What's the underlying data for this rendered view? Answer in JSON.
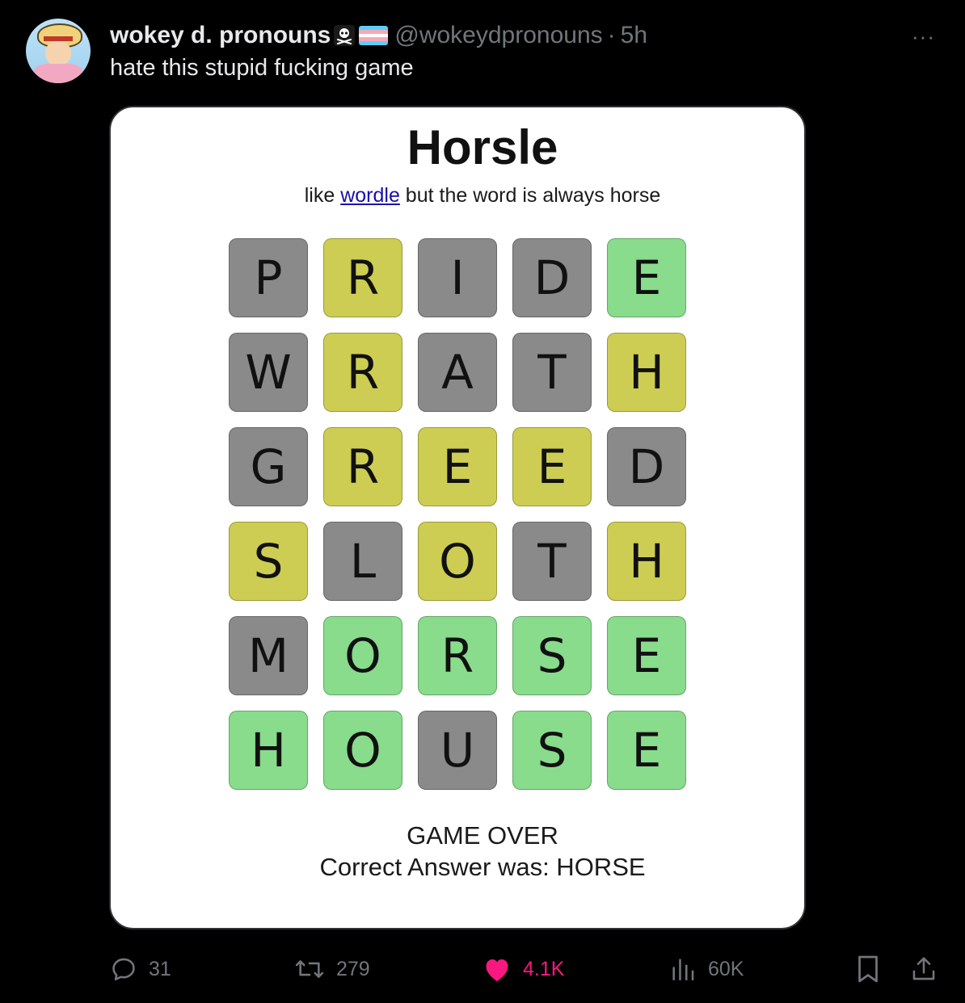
{
  "post": {
    "display_name": "wokey d. pronouns",
    "handle": "@wokeydpronouns",
    "separator": "·",
    "time": "5h",
    "text": "hate this stupid fucking game",
    "emoji": "☠",
    "more": "···"
  },
  "game": {
    "title": "Horsle",
    "subtitle_prefix": "like ",
    "subtitle_link": "wordle",
    "subtitle_suffix": " but the word is always horse",
    "rows": [
      {
        "word": "PRIDE",
        "states": [
          "gray",
          "yellow",
          "gray",
          "gray",
          "green"
        ]
      },
      {
        "word": "WRATH",
        "states": [
          "gray",
          "yellow",
          "gray",
          "gray",
          "yellow"
        ]
      },
      {
        "word": "GREED",
        "states": [
          "gray",
          "yellow",
          "yellow",
          "yellow",
          "gray"
        ]
      },
      {
        "word": "SLOTH",
        "states": [
          "yellow",
          "gray",
          "yellow",
          "gray",
          "yellow"
        ]
      },
      {
        "word": "MORSE",
        "states": [
          "gray",
          "green",
          "green",
          "green",
          "green"
        ]
      },
      {
        "word": "HOUSE",
        "states": [
          "green",
          "green",
          "gray",
          "green",
          "green"
        ]
      }
    ],
    "status_line1": "GAME OVER",
    "status_line2": "Correct Answer was: HORSE"
  },
  "colors": {
    "gray": "#8a8a8a",
    "yellow": "#cdcd53",
    "green": "#88dc8c",
    "like": "#f91880",
    "muted": "#71767b",
    "trans_flag": [
      "#5bcefa",
      "#f5a9b8",
      "#ffffff",
      "#f5a9b8",
      "#5bcefa"
    ]
  },
  "actions": {
    "replies": "31",
    "reposts": "279",
    "likes": "4.1K",
    "views": "60K"
  }
}
